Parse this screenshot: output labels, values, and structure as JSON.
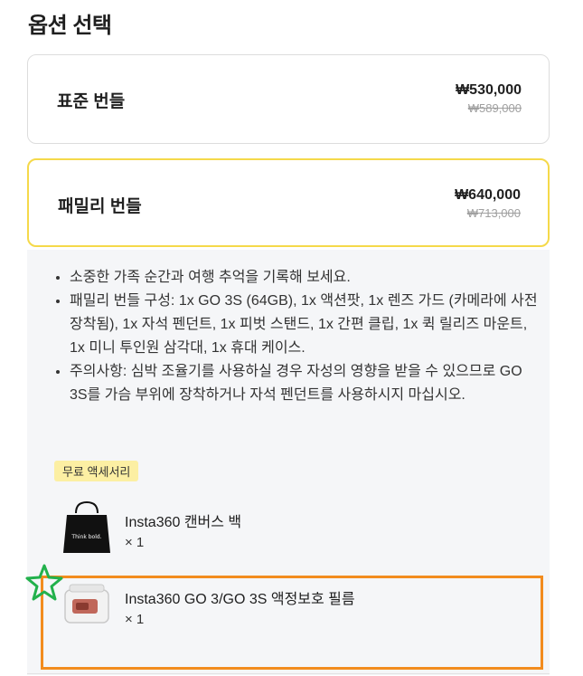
{
  "section": {
    "title": "옵션 선택"
  },
  "options": [
    {
      "name": "표준 번들",
      "price": "₩530,000",
      "original_price": "₩589,000",
      "selected": false
    },
    {
      "name": "패밀리 번들",
      "price": "₩640,000",
      "original_price": "₩713,000",
      "selected": true
    }
  ],
  "details": {
    "bullets": [
      "소중한 가족 순간과 여행 추억을 기록해 보세요.",
      "패밀리 번들 구성: 1x GO 3S (64GB), 1x 액션팟, 1x 렌즈 가드 (카메라에 사전 장착됨), 1x 자석 펜던트, 1x 피벗 스탠드, 1x 간편 클립, 1x 퀵 릴리즈 마운트, 1x 미니 투인원 삼각대, 1x 휴대 케이스.",
      "주의사항: 심박 조율기를 사용하실 경우 자성의 영향을 받을 수 있으므로 GO 3S를 가슴 부위에 장착하거나 자석 펜던트를 사용하시지 마십시오."
    ],
    "badge": "무료 액세서리",
    "accessories": [
      {
        "name": "Insta360 캔버스 백",
        "qty": "× 1",
        "thumb_text": "Think bold."
      },
      {
        "name": "Insta360 GO 3/GO 3S 액정보호 필름",
        "qty": "× 1"
      }
    ]
  },
  "colors": {
    "selected_border": "#f5d94a",
    "badge_bg": "#fcefa3",
    "highlight_orange": "#f28c1e",
    "star_green": "#22b14c"
  }
}
